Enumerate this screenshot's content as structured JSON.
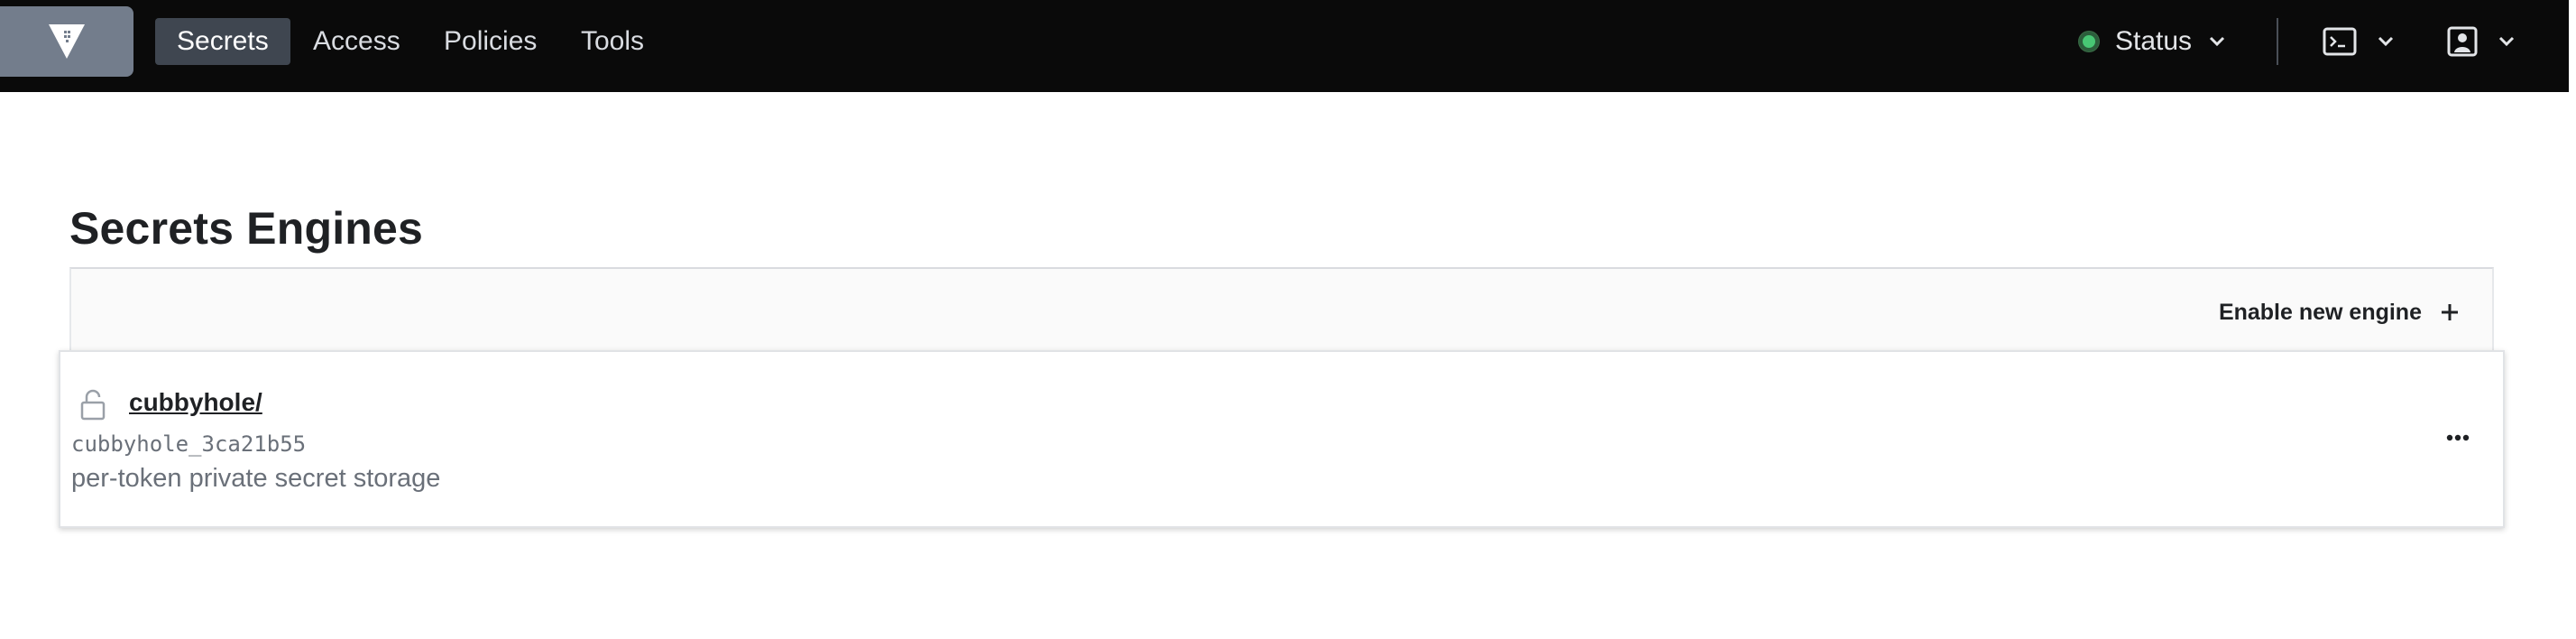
{
  "header": {
    "nav": [
      {
        "label": "Secrets",
        "active": true
      },
      {
        "label": "Access",
        "active": false
      },
      {
        "label": "Policies",
        "active": false
      },
      {
        "label": "Tools",
        "active": false
      }
    ],
    "status_label": "Status",
    "status_color": "#48c774",
    "console_icon": "terminal-icon",
    "user_icon": "user-icon"
  },
  "main": {
    "title": "Secrets Engines",
    "enable_button_label": "Enable new engine",
    "enable_button_icon": "plus-icon",
    "engines": [
      {
        "path": "cubbyhole/",
        "accessor": "cubbyhole_3ca21b55",
        "description": "per-token private secret storage",
        "icon": "lock-icon"
      }
    ]
  }
}
